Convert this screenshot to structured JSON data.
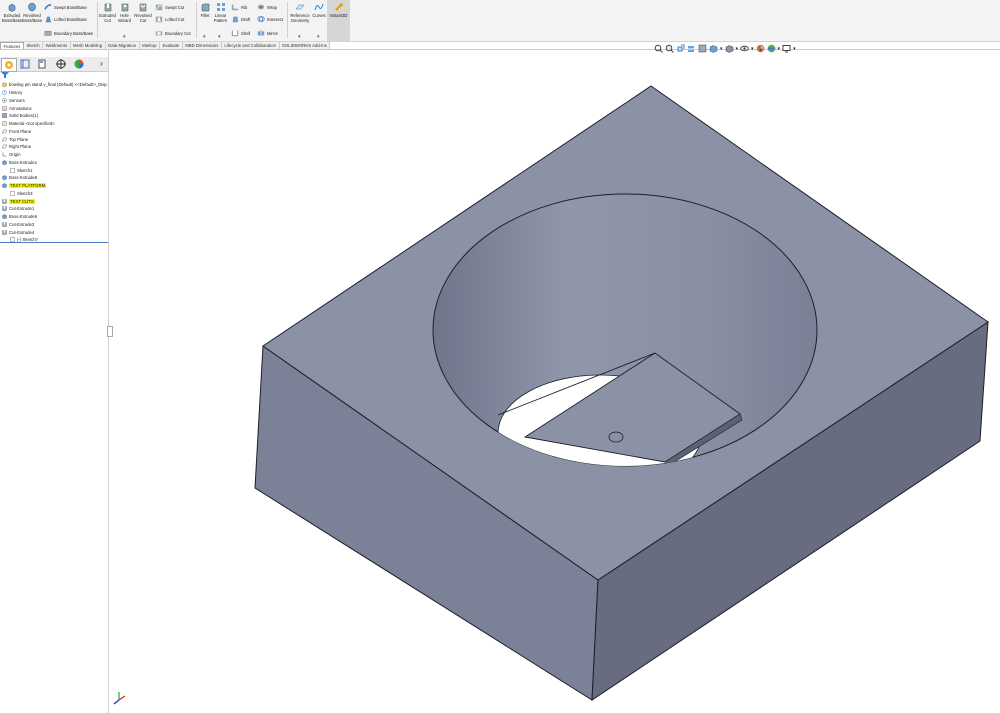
{
  "ribbon": {
    "extruded_boss": "Extruded Boss/Base",
    "revolved_boss": "Revolved Boss/Base",
    "swept_boss": "Swept Boss/Base",
    "lofted_boss": "Lofted Boss/Base",
    "boundary_boss": "Boundary Boss/Base",
    "extruded_cut": "Extruded Cut",
    "hole_wizard": "Hole Wizard",
    "revolved_cut": "Revolved Cut",
    "swept_cut": "Swept Cut",
    "lofted_cut": "Lofted Cut",
    "boundary_cut": "Boundary Cut",
    "fillet": "Fillet",
    "linear_pattern": "Linear Pattern",
    "rib": "Rib",
    "wrap": "Wrap",
    "draft": "Draft",
    "intersect": "Intersect",
    "shell": "Shell",
    "mirror": "Mirror",
    "reference_geometry": "Reference Geometry",
    "curves": "Curves",
    "instant3d": "Instant3D"
  },
  "tabs": [
    "Features",
    "Sketch",
    "Weldments",
    "Mesh Modeling",
    "Data Migration",
    "Markup",
    "Evaluate",
    "MBD Dimensions",
    "Lifecycle and Collaboration",
    "SOLIDWORKS Add-Ins"
  ],
  "tree": {
    "root": "bowling pin stand v_final (Default) <<Default>_Disp",
    "items": [
      {
        "label": "History",
        "icon": "history-icon",
        "indent": 0,
        "highlight": false
      },
      {
        "label": "Sensors",
        "icon": "sensor-icon",
        "indent": 0,
        "highlight": false
      },
      {
        "label": "Annotations",
        "icon": "annotation-icon",
        "indent": 0,
        "highlight": false
      },
      {
        "label": "Solid Bodies(1)",
        "icon": "solid-bodies-icon",
        "indent": 0,
        "highlight": false
      },
      {
        "label": "Material <not specified>",
        "icon": "material-icon",
        "indent": 0,
        "highlight": false
      },
      {
        "label": "Front Plane",
        "icon": "plane-icon",
        "indent": 0,
        "highlight": false
      },
      {
        "label": "Top Plane",
        "icon": "plane-icon",
        "indent": 0,
        "highlight": false
      },
      {
        "label": "Right Plane",
        "icon": "plane-icon",
        "indent": 0,
        "highlight": false
      },
      {
        "label": "Origin",
        "icon": "origin-icon",
        "indent": 0,
        "highlight": false
      },
      {
        "label": "Boss-Extrude1",
        "icon": "extrude-icon",
        "indent": 0,
        "highlight": false
      },
      {
        "label": "Sketch1",
        "icon": "sketch-icon",
        "indent": 1,
        "highlight": false
      },
      {
        "label": "Boss-Extrude5",
        "icon": "extrude-icon",
        "indent": 0,
        "highlight": false
      },
      {
        "label": "TEXT PLATFORM",
        "icon": "extrude-icon",
        "indent": 0,
        "highlight": true
      },
      {
        "label": "Sketch3",
        "icon": "sketch-icon",
        "indent": 1,
        "highlight": false
      },
      {
        "label": "TEXT CUTS",
        "icon": "cut-icon",
        "indent": 0,
        "highlight": true
      },
      {
        "label": "Cut-Extrude1",
        "icon": "cut-icon",
        "indent": 0,
        "highlight": false
      },
      {
        "label": "Boss-Extrude6",
        "icon": "extrude-icon",
        "indent": 0,
        "highlight": false
      },
      {
        "label": "Cut-Extrude3",
        "icon": "cut-icon",
        "indent": 0,
        "highlight": false
      },
      {
        "label": "Cut-Extrude4",
        "icon": "cut-icon",
        "indent": 0,
        "highlight": false
      },
      {
        "label": "(-) Sketch7",
        "icon": "sketch-icon",
        "indent": 1,
        "highlight": false
      }
    ]
  },
  "colors": {
    "part_top": "#8c92a6",
    "part_left": "#7b8197",
    "part_right": "#676c7f",
    "highlight": "#f4f500",
    "rollback_bar": "#4a7fd0"
  }
}
